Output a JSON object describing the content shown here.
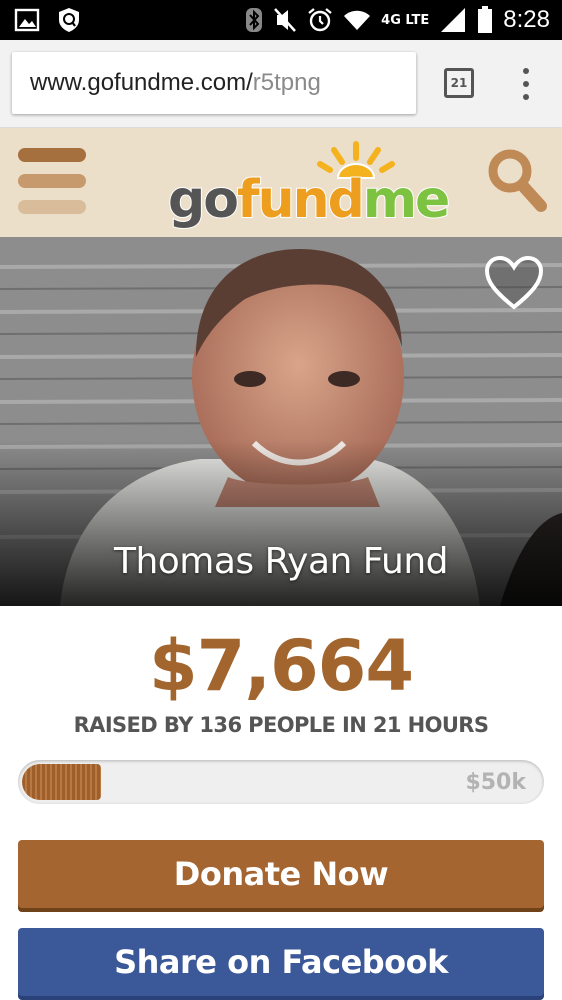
{
  "status_bar": {
    "network": "4G LTE",
    "time": "8:28",
    "icons": [
      "image-icon",
      "location-shield-icon",
      "bluetooth-icon",
      "mute-icon",
      "alarm-icon",
      "wifi-icon",
      "signal-icon",
      "battery-icon"
    ]
  },
  "browser": {
    "url_host": "www.gofundme.com/",
    "url_path": "r5tpng",
    "tab_count": "21"
  },
  "header": {
    "logo_go": "go",
    "logo_fund": "fund",
    "logo_me": "me",
    "icons": [
      "hamburger-icon",
      "search-icon"
    ]
  },
  "campaign": {
    "title": "Thomas Ryan Fund",
    "amount": "$7,664",
    "raised_text": "RAISED BY 136 PEOPLE IN 21 HOURS",
    "goal": "$50k",
    "progress_fraction": 0.153
  },
  "actions": {
    "donate_label": "Donate Now",
    "share_label": "Share on Facebook"
  },
  "colors": {
    "brand_brown": "#a46530",
    "header_bg": "#ecdfca",
    "facebook_blue": "#3b5998",
    "logo_orange": "#ee9e1e",
    "logo_green": "#7ec241"
  }
}
